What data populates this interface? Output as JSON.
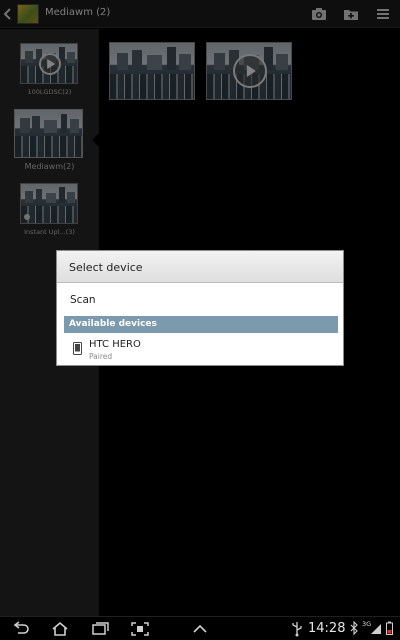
{
  "action_bar": {
    "title": "Mediawm (2)",
    "icons": [
      "back-chevron-icon",
      "album-thumbnail",
      "camera-icon",
      "new-folder-icon",
      "overflow-menu-icon"
    ]
  },
  "albums": [
    {
      "label": "100LGDSC(2)",
      "type": "video"
    },
    {
      "label": "Mediawm(2)",
      "type": "photo",
      "selected": true
    },
    {
      "label": "Instant Upl...(3)",
      "type": "photo"
    }
  ],
  "grid": [
    {
      "type": "photo"
    },
    {
      "type": "video"
    }
  ],
  "dialog": {
    "title": "Select device",
    "scan_label": "Scan",
    "section_title": "Available devices",
    "devices": [
      {
        "name": "HTC HERO",
        "status": "Paired",
        "icon": "phone-icon"
      }
    ],
    "section_color": "#7b9aad"
  },
  "status_bar": {
    "time": "14:28",
    "network": "3G",
    "icons": [
      "back-icon",
      "home-icon",
      "recent-apps-icon",
      "screen-capture-icon",
      "up-arrow-icon",
      "usb-icon",
      "bluetooth-icon",
      "signal-icon",
      "battery-icon"
    ]
  }
}
